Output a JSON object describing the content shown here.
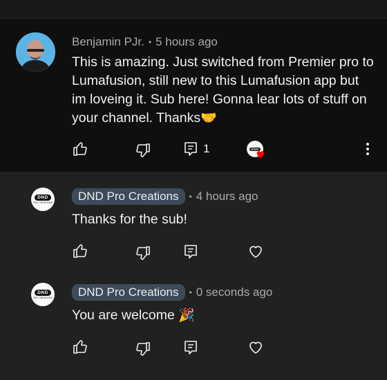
{
  "comment": {
    "author": "Benjamin PJr.",
    "time": "5 hours ago",
    "text": "This is amazing. Just switched from Premier pro to Lumafusion, still new to this Lumafusion app but im loveing it. Sub here! Gonna lear lots of stuff on your channel. Thanks",
    "text_emoji": "🤝",
    "reply_count": "1",
    "icons": {
      "like": "thumbs-up-icon",
      "dislike": "thumbs-down-icon",
      "reply": "reply-icon",
      "creator_heart": "creator-heart-icon",
      "more": "more-vert-icon"
    }
  },
  "replies": [
    {
      "author": "DND Pro Creations",
      "avatar_text": "DND",
      "avatar_subtext": "PRO CREATIONS",
      "time": "4 hours ago",
      "text": "Thanks for the sub!",
      "emoji": ""
    },
    {
      "author": "DND Pro Creations",
      "avatar_text": "DND",
      "avatar_subtext": "PRO CREATIONS",
      "time": "0 seconds ago",
      "text": "You are welcome",
      "emoji": "🎉"
    }
  ],
  "colors": {
    "background": "#212121",
    "highlight": "#0f0f0f",
    "chip": "#3f4a58",
    "heart": "#ff0000"
  }
}
